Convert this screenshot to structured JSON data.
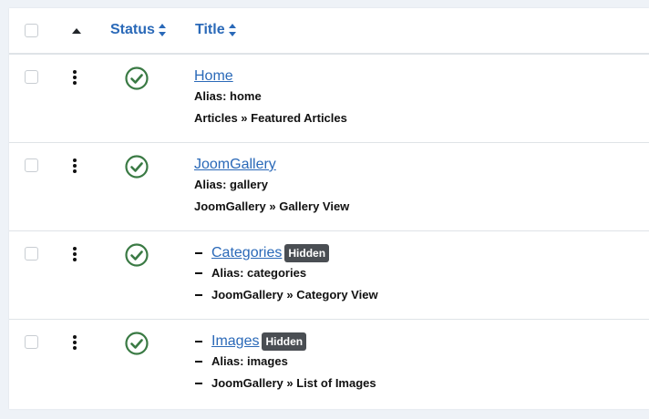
{
  "header": {
    "status_label": "Status",
    "title_label": "Title"
  },
  "colors": {
    "link": "#2a69b8",
    "published": "#3a7a44",
    "badge": "#4a4e53"
  },
  "rows": [
    {
      "title": "Home",
      "alias": "Alias: home",
      "path": "Articles » Featured Articles",
      "badge": "",
      "level": 1,
      "status_icon": "published-check-icon"
    },
    {
      "title": "JoomGallery",
      "alias": "Alias: gallery",
      "path": "JoomGallery » Gallery View",
      "badge": "",
      "level": 1,
      "status_icon": "published-check-icon"
    },
    {
      "title": "Categories",
      "alias": "Alias: categories",
      "path": "JoomGallery » Category View",
      "badge": "Hidden",
      "level": 2,
      "status_icon": "published-check-icon"
    },
    {
      "title": "Images",
      "alias": "Alias: images",
      "path": "JoomGallery » List of Images",
      "badge": "Hidden",
      "level": 2,
      "status_icon": "published-check-icon"
    }
  ]
}
